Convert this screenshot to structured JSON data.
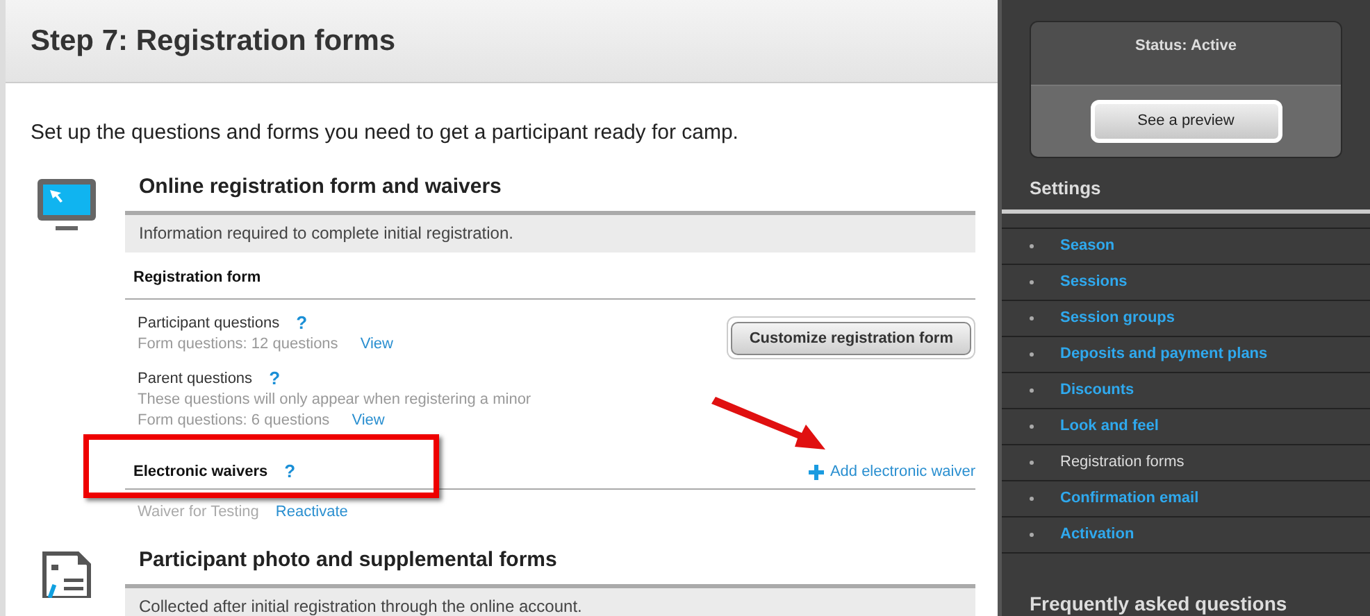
{
  "page_title": "Step 7: Registration forms",
  "intro": "Set up the questions and forms you need to get a participant ready for camp.",
  "sections": [
    {
      "kind": "online",
      "title": "Online registration form and waivers",
      "info": "Information required to complete initial registration.",
      "registration_form": {
        "heading": "Registration form",
        "button": "Customize registration form",
        "groups": [
          {
            "name": "Participant questions",
            "help": "?",
            "count": "Form questions: 12 questions",
            "link": "View"
          },
          {
            "name": "Parent questions",
            "help": "?",
            "note": "These questions will only appear when registering a minor",
            "count": "Form questions: 6 questions",
            "link": "View"
          }
        ]
      },
      "waivers": {
        "heading": "Electronic waivers",
        "help": "?",
        "add_link": "Add electronic waiver",
        "items": [
          {
            "name": "Waiver for Testing",
            "link": "Reactivate"
          }
        ]
      }
    },
    {
      "kind": "forms",
      "title": "Participant photo and supplemental forms",
      "info": "Collected after initial registration through the online account."
    }
  ],
  "status": {
    "label": "Status: Active",
    "button": "See a preview"
  },
  "settings": {
    "title": "Settings",
    "items": [
      {
        "label": "Season",
        "selected": false
      },
      {
        "label": "Sessions",
        "selected": false
      },
      {
        "label": "Session groups",
        "selected": false
      },
      {
        "label": "Deposits and payment plans",
        "selected": false
      },
      {
        "label": "Discounts",
        "selected": false
      },
      {
        "label": "Look and feel",
        "selected": false
      },
      {
        "label": "Registration forms",
        "selected": true
      },
      {
        "label": "Confirmation email",
        "selected": false
      },
      {
        "label": "Activation",
        "selected": false
      }
    ]
  },
  "faq": {
    "title": "Frequently asked questions"
  }
}
